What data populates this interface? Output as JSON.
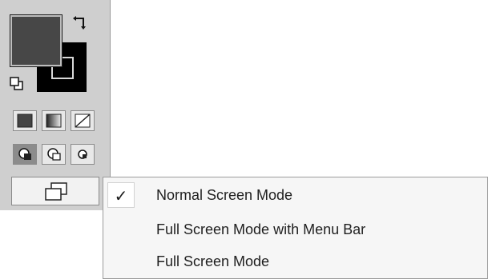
{
  "toolbox": {
    "foreground_color": "#474747",
    "background_color": "#000000",
    "swap_icon": "swap-arrows-icon",
    "default_icon": "default-colors-icon",
    "fill_buttons": [
      {
        "name": "solid-color-fill",
        "icon": "solid-fill-icon"
      },
      {
        "name": "gradient-fill",
        "icon": "gradient-fill-icon"
      },
      {
        "name": "no-fill",
        "icon": "no-fill-icon"
      }
    ],
    "mask_buttons": [
      {
        "name": "mask-mode-1",
        "icon": "mask-1-icon",
        "active": true
      },
      {
        "name": "mask-mode-2",
        "icon": "mask-2-icon",
        "active": false
      },
      {
        "name": "mask-mode-3",
        "icon": "mask-3-icon",
        "active": false
      }
    ],
    "screen_mode_icon": "screen-mode-icon"
  },
  "screen_mode_menu": {
    "items": [
      {
        "label": "Normal Screen Mode",
        "checked": true
      },
      {
        "label": "Full Screen Mode with Menu Bar",
        "checked": false
      },
      {
        "label": "Full Screen Mode",
        "checked": false
      }
    ],
    "check_glyph": "✓"
  }
}
